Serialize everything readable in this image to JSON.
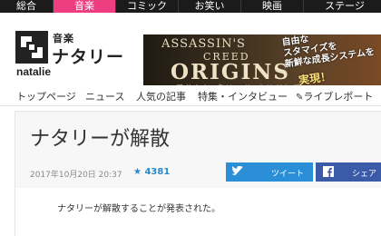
{
  "topnav": {
    "tabs": [
      {
        "label": "総合",
        "active": false
      },
      {
        "label": "音楽",
        "active": true
      },
      {
        "label": "コミック",
        "active": false
      },
      {
        "label": "お笑い",
        "active": false
      },
      {
        "label": "映画",
        "active": false
      },
      {
        "label": "ステージ",
        "active": false
      }
    ]
  },
  "header": {
    "logo_small": "音楽",
    "logo_big": "ナタリー",
    "logo_text": "natalie"
  },
  "banner": {
    "line1": "ASSASSIN'S",
    "line2": "CREED",
    "line3": "ORIGINS",
    "line4": "アサシン クリード オリジンズ",
    "copy": "自由な\nスタマイズを\n新鮮な成長システムを",
    "cta": "実現！"
  },
  "subnav": {
    "items": [
      "トップページ",
      "ニュース",
      "人気の記事",
      "特集・インタビュー",
      "ライブレポート"
    ]
  },
  "article": {
    "title": "ナタリーが解散",
    "date": "2017年10月20日 20:37",
    "score": "4381",
    "tweet_label": "ツイート",
    "share_label": "シェア",
    "lead": "ナタリーが解散することが発表された。"
  },
  "colors": {
    "accent_pink": "#ef3d82",
    "twitter": "#2b8fd8",
    "facebook": "#3b5aa8",
    "score": "#2b89c8"
  }
}
